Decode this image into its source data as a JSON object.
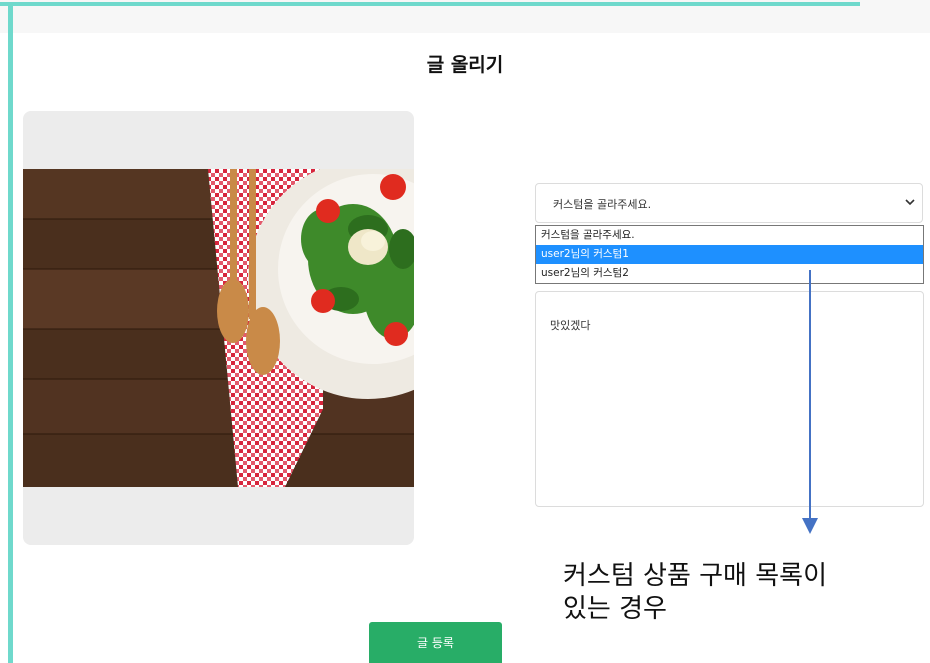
{
  "colors": {
    "accent_teal": "#6fd9cc",
    "submit_green": "#28ad67",
    "selected_blue": "#1e90ff"
  },
  "page": {
    "title": "글 올리기"
  },
  "image": {
    "alt": ""
  },
  "custom_select": {
    "value": "커스텀을 골라주세요.",
    "options": [
      "커스텀을 골라주세요.",
      "user2님의 커스텀1",
      "user2님의 커스텀2"
    ],
    "highlighted": "user2님의 커스텀1"
  },
  "content": {
    "text": "맛있겠다"
  },
  "annotation": {
    "line1": "커스텀 상품 구매 목록이",
    "line2": "있는 경우"
  },
  "submit": {
    "label": "글 등록"
  }
}
